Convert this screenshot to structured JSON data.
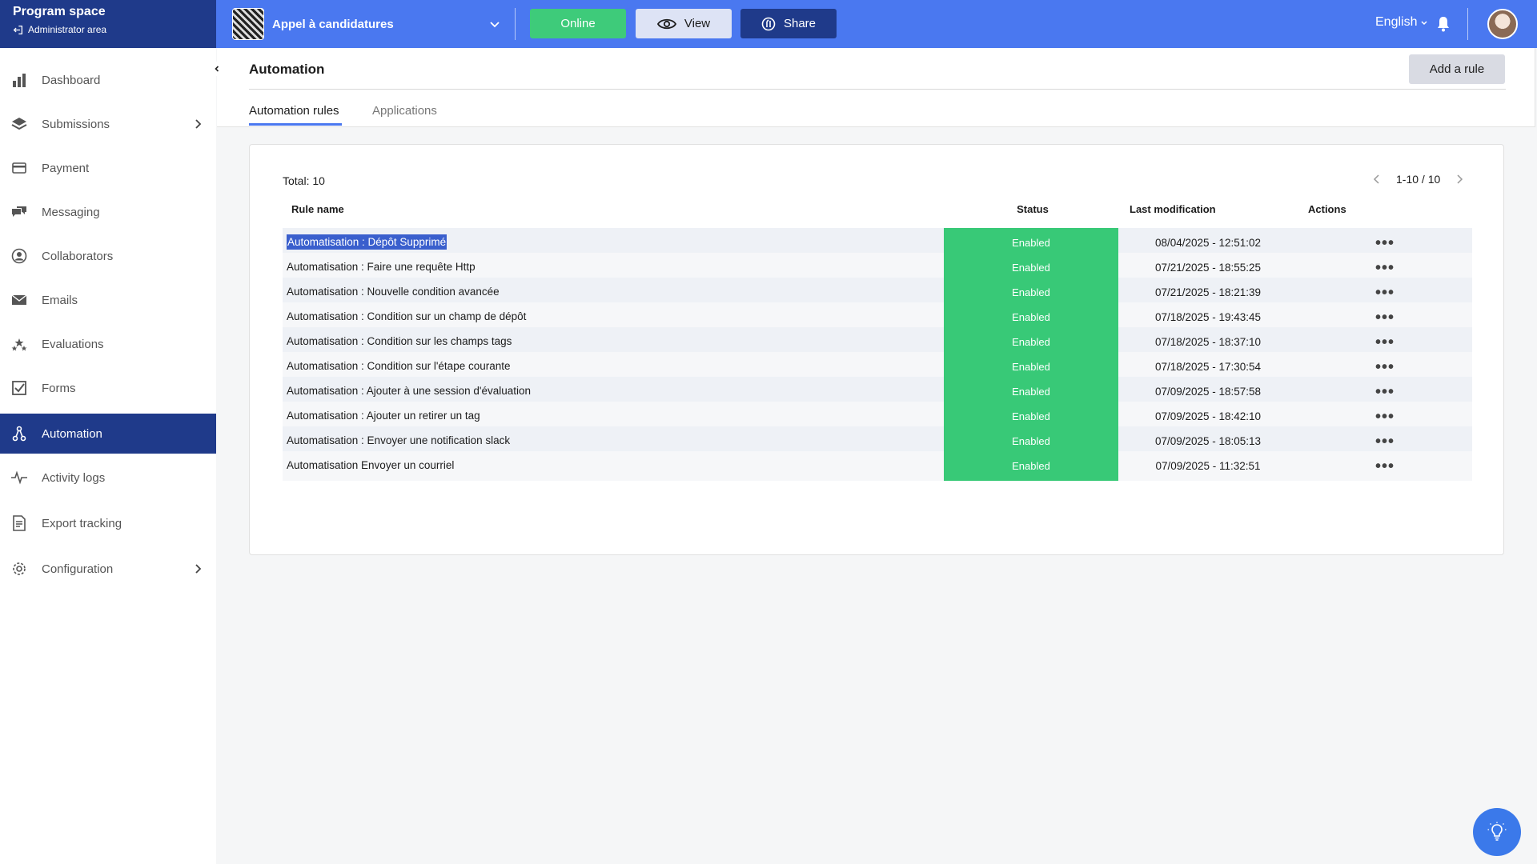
{
  "brand": {
    "title": "Program space",
    "subtitle": "Administrator area"
  },
  "program": {
    "name": "Appel à candidatures"
  },
  "topbar": {
    "online_label": "Online",
    "view_label": "View",
    "share_label": "Share",
    "language": "English"
  },
  "colors": {
    "primary": "#4a78f0",
    "dark": "#1f3a8a",
    "success": "#38c977"
  },
  "sidebar": {
    "items": [
      {
        "label": "Dashboard",
        "icon": "bar-chart-icon"
      },
      {
        "label": "Submissions",
        "icon": "layers-icon"
      },
      {
        "label": "Payment",
        "icon": "credit-card-icon"
      },
      {
        "label": "Messaging",
        "icon": "chat-icon"
      },
      {
        "label": "Collaborators",
        "icon": "person-icon"
      },
      {
        "label": "Emails",
        "icon": "envelope-icon"
      },
      {
        "label": "Evaluations",
        "icon": "stars-icon"
      },
      {
        "label": "Forms",
        "icon": "checkbox-icon"
      },
      {
        "label": "Automation",
        "icon": "automation-icon"
      },
      {
        "label": "Activity logs",
        "icon": "pulse-icon"
      },
      {
        "label": "Export tracking",
        "icon": "document-icon"
      },
      {
        "label": "Configuration",
        "icon": "gear-icon"
      }
    ]
  },
  "page": {
    "title": "Automation",
    "add_rule_label": "Add a rule",
    "tabs": [
      "Automation rules",
      "Applications"
    ]
  },
  "table": {
    "total": "Total: 10",
    "pagination": "1-10 / 10",
    "headers": {
      "name": "Rule name",
      "status": "Status",
      "modified": "Last modification",
      "actions": "Actions"
    },
    "rows": [
      {
        "name": "Automatisation : Dépôt Supprimé",
        "status": "Enabled",
        "modified": "08/04/2025 - 12:51:02"
      },
      {
        "name": "Automatisation : Faire une requête Http",
        "status": "Enabled",
        "modified": "07/21/2025 - 18:55:25"
      },
      {
        "name": "Automatisation : Nouvelle condition avancée",
        "status": "Enabled",
        "modified": "07/21/2025 - 18:21:39"
      },
      {
        "name": "Automatisation : Condition sur un champ de dépôt",
        "status": "Enabled",
        "modified": "07/18/2025 - 19:43:45"
      },
      {
        "name": "Automatisation : Condition sur les champs tags",
        "status": "Enabled",
        "modified": "07/18/2025 - 18:37:10"
      },
      {
        "name": "Automatisation : Condition sur l'étape courante",
        "status": "Enabled",
        "modified": "07/18/2025 - 17:30:54"
      },
      {
        "name": "Automatisation : Ajouter à une session d'évaluation",
        "status": "Enabled",
        "modified": "07/09/2025 - 18:57:58"
      },
      {
        "name": "Automatisation : Ajouter un retirer un tag",
        "status": "Enabled",
        "modified": "07/09/2025 - 18:42:10"
      },
      {
        "name": "Automatisation : Envoyer une notification slack",
        "status": "Enabled",
        "modified": "07/09/2025 - 18:05:13"
      },
      {
        "name": "Automatisation Envoyer un courriel",
        "status": "Enabled",
        "modified": "07/09/2025 - 11:32:51"
      }
    ]
  }
}
